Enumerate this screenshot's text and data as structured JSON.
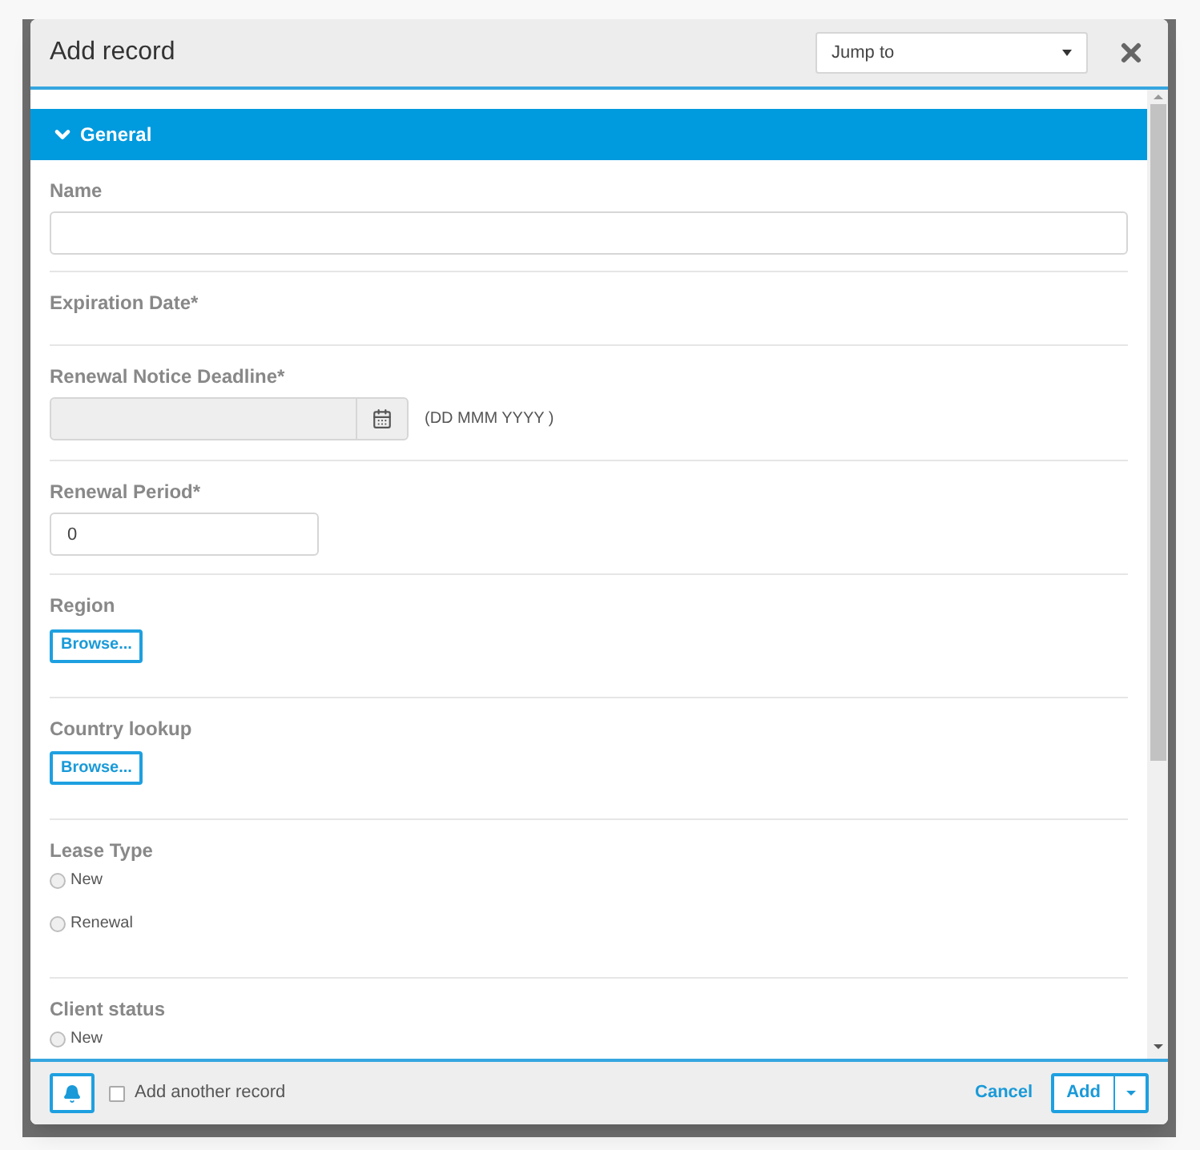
{
  "dialog": {
    "title": "Add record",
    "jump_to": {
      "value": "Jump to"
    }
  },
  "section": {
    "title": "General",
    "expanded": true
  },
  "fields": [
    {
      "kind": "text",
      "label": "Name"
    },
    {
      "kind": "label",
      "label": "Expiration Date*"
    },
    {
      "kind": "date",
      "label": "Renewal Notice Deadline*",
      "disabled": true,
      "hint": "(DD MMM YYYY )"
    },
    {
      "kind": "number",
      "label": "Renewal Period*",
      "value": "0"
    },
    {
      "kind": "browse",
      "label": "Region",
      "button": "Browse..."
    },
    {
      "kind": "browse",
      "label": "Country lookup",
      "button": "Browse..."
    },
    {
      "kind": "radio",
      "label": "Lease Type",
      "options": [
        {
          "label": "New",
          "selected": false
        },
        {
          "label": "Renewal",
          "selected": false
        }
      ]
    },
    {
      "kind": "radio",
      "label": "Client status",
      "options": [
        {
          "label": "New",
          "selected": false
        }
      ]
    }
  ],
  "footer": {
    "add_another": {
      "label": "Add another record",
      "checked": false
    },
    "cancel": "Cancel",
    "add": "Add"
  }
}
